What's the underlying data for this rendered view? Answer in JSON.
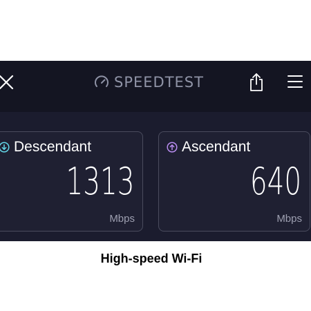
{
  "app": {
    "logo_text": "SPEEDTEST",
    "logo_icon": "speedometer-icon",
    "close_icon": "close-icon",
    "share_icon": "share-icon",
    "menu_icon": "hamburger-menu-icon"
  },
  "download": {
    "label": "Descendant",
    "value": "1313",
    "unit": "Mbps",
    "icon": "arrow-down-circle-icon",
    "accent": "#64d7e8"
  },
  "upload": {
    "label": "Ascendant",
    "value": "640",
    "unit": "Mbps",
    "icon": "arrow-up-circle-icon",
    "accent": "#b98cf0"
  },
  "caption": "High-speed Wi-Fi",
  "colors": {
    "topbar": "#141522",
    "background": "#1b1c2e",
    "card_border": "#4a4c5e",
    "logo_gray": "#8f93a6"
  }
}
